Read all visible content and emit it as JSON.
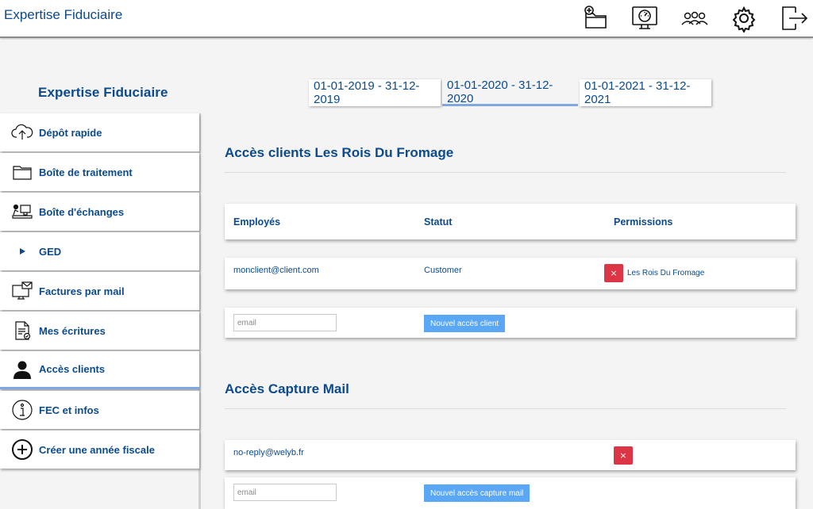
{
  "app": {
    "title": "Expertise Fiduciaire"
  },
  "top_icons": [
    "add-folder-icon",
    "dashboard-icon",
    "users-icon",
    "gear-icon",
    "logout-icon"
  ],
  "company": {
    "name": "Expertise Fiduciaire"
  },
  "year_tabs": [
    {
      "label": "01-01-2019 - 31-12-2019",
      "active": false
    },
    {
      "label": "01-01-2020 - 31-12-2020",
      "active": true
    },
    {
      "label": "01-01-2021 - 31-12-2021",
      "active": false
    }
  ],
  "sidebar": {
    "items": [
      {
        "label": "Dépôt rapide",
        "icon": "cloud-upload-icon"
      },
      {
        "label": "Boîte de traitement",
        "icon": "folder-icon"
      },
      {
        "label": "Boîte d'échanges",
        "icon": "desk-exchange-icon"
      },
      {
        "label": "GED",
        "icon": "play-icon"
      },
      {
        "label": "Factures par mail",
        "icon": "mail-monitor-icon"
      },
      {
        "label": "Mes écritures",
        "icon": "document-check-icon"
      },
      {
        "label": "Accès clients",
        "icon": "person-icon",
        "active": true
      },
      {
        "label": "FEC et infos",
        "icon": "info-icon"
      },
      {
        "label": "Créer une année fiscale",
        "icon": "plus-circle-icon"
      }
    ]
  },
  "clients_section": {
    "title": "Accès clients Les Rois Du Fromage",
    "headers": {
      "employees": "Employés",
      "status": "Statut",
      "permissions": "Permissions"
    },
    "rows": [
      {
        "email": "monclient@client.com",
        "status": "Customer",
        "permission": "Les Rois Du Fromage",
        "delete_label": "×"
      }
    ],
    "new_email_placeholder": "email",
    "new_button": "Nouvel accès client"
  },
  "capture_section": {
    "title": "Accès Capture Mail",
    "rows": [
      {
        "email": "no-reply@welyb.fr",
        "delete_label": "×"
      }
    ],
    "new_email_placeholder": "email",
    "new_button": "Nouvel accès capture mail"
  },
  "colors": {
    "brand": "#0b4a8c",
    "accent": "#5aa7f5",
    "danger": "#dc3545",
    "active_underline": "#7fa8e0"
  }
}
